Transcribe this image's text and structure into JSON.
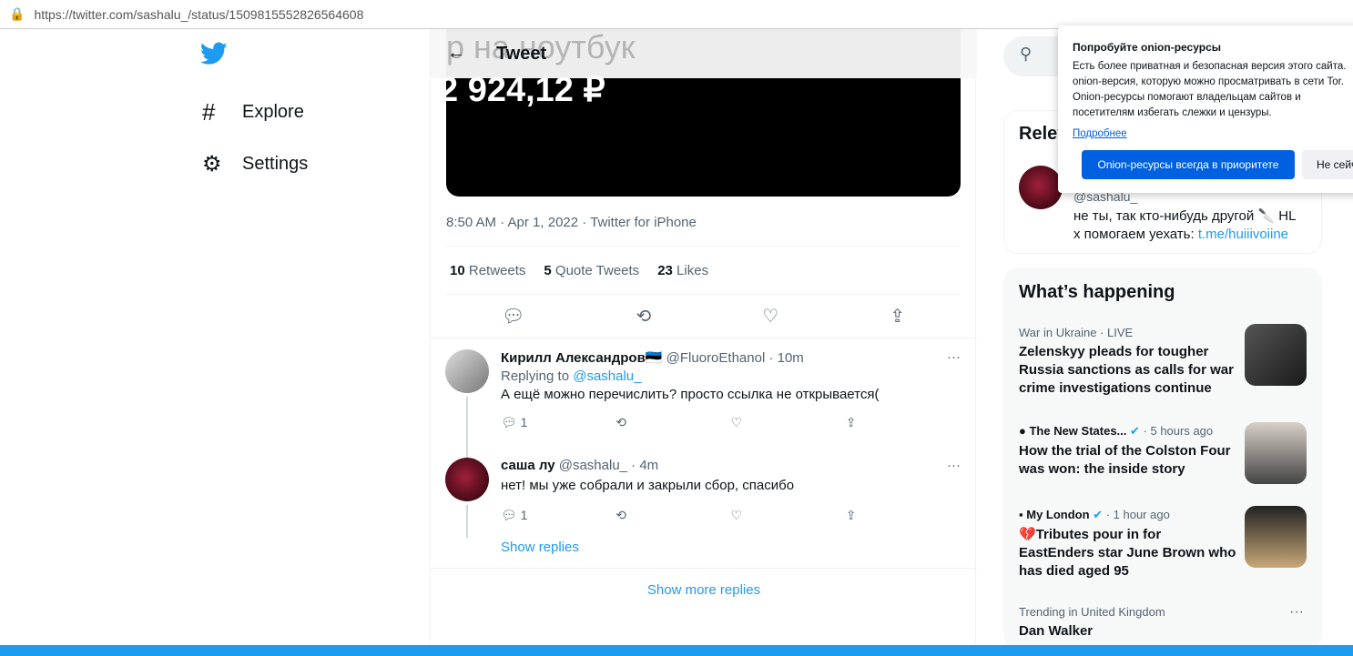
{
  "browser": {
    "url": "https://twitter.com/sashalu_/status/1509815552826564608"
  },
  "sidebar": {
    "items": [
      {
        "label": "Explore",
        "icon": "hashtag-icon"
      },
      {
        "label": "Settings",
        "icon": "gear-icon"
      }
    ]
  },
  "header": {
    "title": "Tweet"
  },
  "tweet": {
    "image_text_top": "р на ноутбук",
    "image_text_amount": "2 924,12 ₽",
    "timestamp": "8:50 AM · Apr 1, 2022 · Twitter for iPhone",
    "retweets": "10",
    "retweets_label": "Retweets",
    "quotes": "5",
    "quotes_label": "Quote Tweets",
    "likes": "23",
    "likes_label": "Likes"
  },
  "replies": [
    {
      "name": "Кирилл Александров🇪🇪",
      "handle": "@FluoroEthanol · 10m",
      "replying_prefix": "Replying to ",
      "replying_to": "@sashalu_",
      "text": "А ещё можно перечислить? просто ссылка не открывается(",
      "reply_count": "1"
    },
    {
      "name": "саша лу",
      "handle": "@sashalu_ · 4m",
      "text": "нет! мы уже собрали и закрыли сбор, спасибо",
      "reply_count": "1",
      "show_replies": "Show replies"
    }
  ],
  "show_more_replies": "Show more replies",
  "relevant": {
    "title": "Relevant people",
    "handle": "@sashalu_",
    "bio1": "не ты, так кто-нибудь другой 🔪 HL",
    "bio2": "х помогаем уехать: ",
    "link": "t.me/huiiivoiine"
  },
  "whats_happening": {
    "title": "What’s happening",
    "trends": [
      {
        "context": "War in Ukraine · LIVE",
        "headline": "Zelenskyy pleads for tougher Russia sanctions as calls for war crime investigations continue"
      },
      {
        "context_source": "The New States...",
        "context_time": " · 5 hours ago",
        "headline": "How the trial of the Colston Four was won: the inside story"
      },
      {
        "context_source": "My London",
        "context_time": " · 1 hour ago",
        "headline": "💔Tributes pour in for EastEnders star June Brown who has died aged 95"
      },
      {
        "context": "Trending in United Kingdom",
        "headline": "Dan Walker"
      }
    ]
  },
  "popup": {
    "title": "Попробуйте onion-ресурсы",
    "body": "Есть более приватная и безопасная версия этого сайта. onion-версия, которую можно просматривать в сети Tor. Onion-ресурсы помогают владельцам сайтов и посетителям избегать слежки и цензуры.",
    "learn_more": "Подробнее",
    "primary": "Onion-ресурсы всегда в приоритете",
    "secondary": "Не сейчас"
  },
  "colors": {
    "accent": "#1d9bf0",
    "popup_button": "#0061e0"
  }
}
